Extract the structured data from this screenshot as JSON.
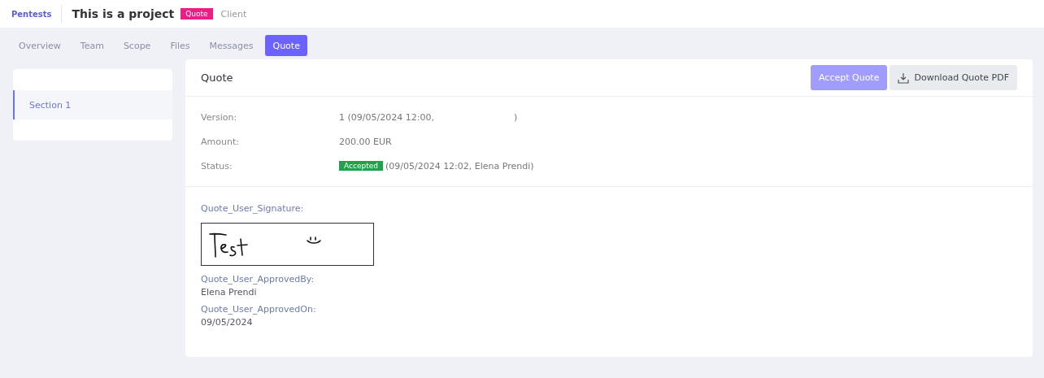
{
  "header": {
    "breadcrumb": "Pentests",
    "title": "This is a project",
    "badge": "Quote",
    "role": "Client"
  },
  "tabs": [
    {
      "label": "Overview",
      "selected": false
    },
    {
      "label": "Team",
      "selected": false
    },
    {
      "label": "Scope",
      "selected": false
    },
    {
      "label": "Files",
      "selected": false
    },
    {
      "label": "Messages",
      "selected": false
    },
    {
      "label": "Quote",
      "selected": true
    }
  ],
  "sidebar": {
    "items": [
      {
        "label": "Section 1",
        "selected": true
      }
    ]
  },
  "panel": {
    "title": "Quote",
    "buttons": [
      {
        "kind": "primary",
        "label": "Accept Quote",
        "disabled": true
      },
      {
        "kind": "download",
        "label": "Download Quote PDF",
        "disabled": false
      }
    ],
    "fields": [
      {
        "label": "Version:",
        "value": "1 (09/05/2024 12:00,",
        "value_end": ")"
      },
      {
        "label": "Amount:",
        "value": "200.00 EUR"
      },
      {
        "label": "Status:",
        "status": "Accepted",
        "value": "(09/05/2024 12:02, Elena Prendi)"
      }
    ],
    "signature_label": "Quote_User_Signature:",
    "approvals": [
      {
        "label": "Quote_User_ApprovedBy:",
        "value": "Elena Prendi"
      },
      {
        "label": "Quote_User_ApprovedOn:",
        "value": "09/05/2024"
      }
    ]
  }
}
